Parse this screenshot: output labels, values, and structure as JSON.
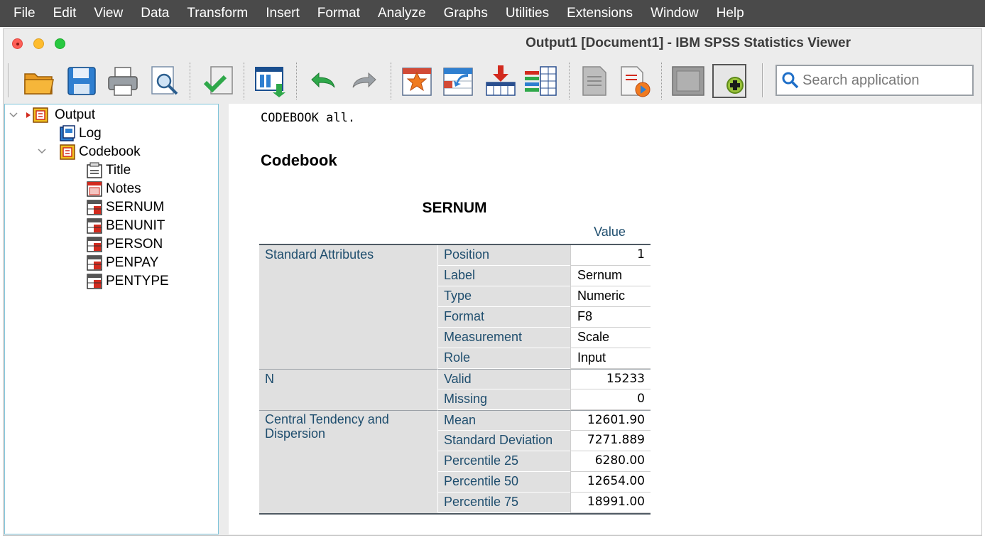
{
  "menubar": {
    "items": [
      "File",
      "Edit",
      "View",
      "Data",
      "Transform",
      "Insert",
      "Format",
      "Analyze",
      "Graphs",
      "Utilities",
      "Extensions",
      "Window",
      "Help"
    ]
  },
  "window": {
    "title": "Output1 [Document1] - IBM SPSS Statistics Viewer"
  },
  "toolbar": {
    "buttons": [
      "open-icon",
      "save-icon",
      "print-icon",
      "print-preview-icon",
      "export-icon",
      "recall-dialog-icon",
      "undo-icon",
      "redo-icon",
      "goto-data-icon",
      "goto-case-icon",
      "goto-variable-icon",
      "variables-icon",
      "designate-window-icon",
      "run-script-icon",
      "hide-icon",
      "insert-output-icon"
    ],
    "search_placeholder": "Search application"
  },
  "outline": {
    "root": "Output",
    "log": "Log",
    "codebook": "Codebook",
    "children": [
      "Title",
      "Notes",
      "SERNUM",
      "BENUNIT",
      "PERSON",
      "PENPAY",
      "PENTYPE"
    ]
  },
  "content": {
    "syntax": "CODEBOOK all.",
    "heading": "Codebook",
    "table": {
      "title": "SERNUM",
      "column_header": "Value",
      "groups": [
        {
          "label": "Standard Attributes",
          "rows": [
            {
              "label": "Position",
              "value": "1",
              "numeric": true
            },
            {
              "label": "Label",
              "value": "Sernum",
              "numeric": false
            },
            {
              "label": "Type",
              "value": "Numeric",
              "numeric": false
            },
            {
              "label": "Format",
              "value": "F8",
              "numeric": false
            },
            {
              "label": "Measurement",
              "value": "Scale",
              "numeric": false
            },
            {
              "label": "Role",
              "value": "Input",
              "numeric": false
            }
          ]
        },
        {
          "label": "N",
          "rows": [
            {
              "label": "Valid",
              "value": "15233",
              "numeric": true
            },
            {
              "label": "Missing",
              "value": "0",
              "numeric": true
            }
          ]
        },
        {
          "label": "Central Tendency and Dispersion",
          "rows": [
            {
              "label": "Mean",
              "value": "12601.90",
              "numeric": true
            },
            {
              "label": "Standard Deviation",
              "value": "7271.889",
              "numeric": true
            },
            {
              "label": "Percentile 25",
              "value": "6280.00",
              "numeric": true
            },
            {
              "label": "Percentile 50",
              "value": "12654.00",
              "numeric": true
            },
            {
              "label": "Percentile 75",
              "value": "18991.00",
              "numeric": true
            }
          ]
        }
      ]
    }
  },
  "colors": {
    "menubar_bg": "#4a4a4a",
    "row_header_text": "#1f4e6e",
    "row_header_bg": "#e0e0e0",
    "outline_border": "#7fc3d9"
  }
}
